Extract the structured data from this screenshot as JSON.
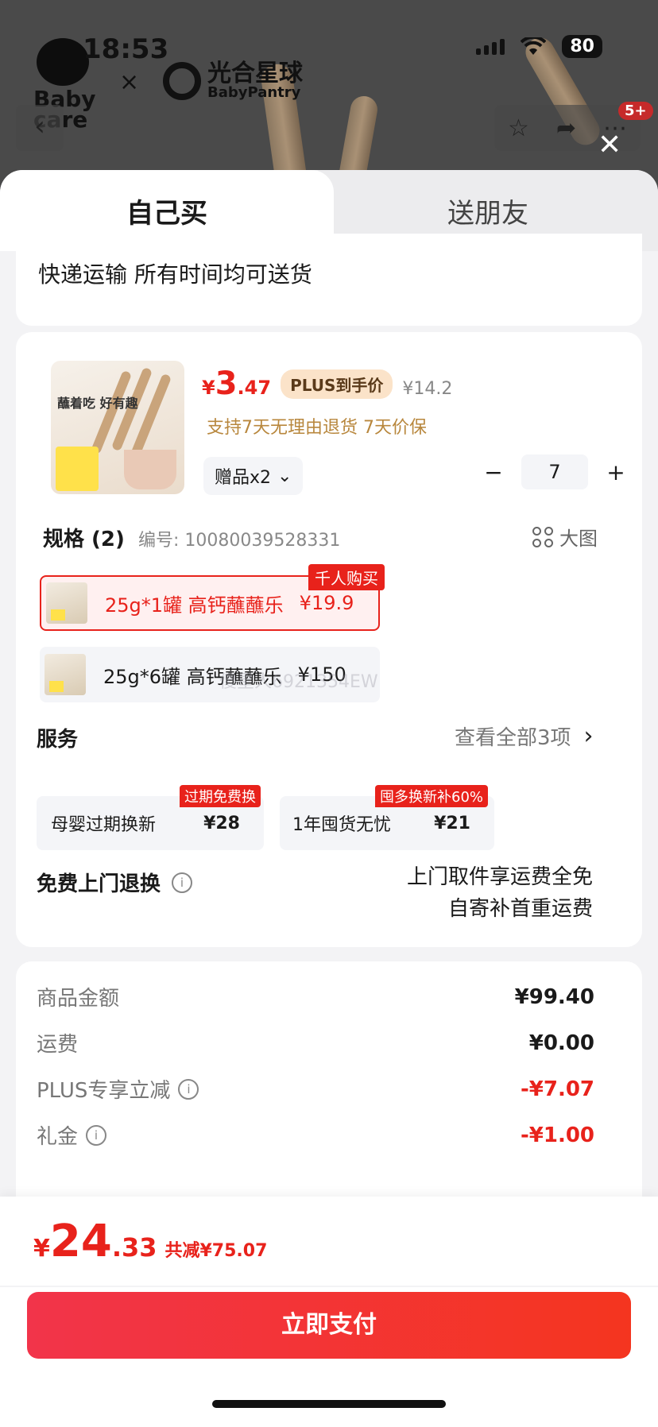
{
  "status_bar": {
    "time": "18:53",
    "battery": "80"
  },
  "header": {
    "brand_left": "Baby care",
    "brand_separator": "×",
    "brand_right_cn": "光合星球",
    "brand_right_en": "BabyPantry",
    "notification_count": "5+"
  },
  "tabs": {
    "self": "自己买",
    "gift": "送朋友"
  },
  "delivery": {
    "text": "快递运输 所有时间均可送货"
  },
  "product": {
    "thumb_text": "蘸着吃 好有趣",
    "price_currency": "¥",
    "price_int": "3",
    "price_dec": ".47",
    "plus_label": "PLUS到手价",
    "original_price": "¥14.2",
    "support_text": "支持7天无理由退货  7天价保",
    "gift_label": "赠品x2",
    "quantity": "7",
    "minus": "−",
    "plus": "+"
  },
  "spec": {
    "title": "规格 (2)",
    "code": "编号: 10080039528331",
    "big_image": "大图",
    "options": [
      {
        "name": "25g*1罐 高钙蘸蘸乐",
        "price": "¥19.9",
        "badge": "千人购买",
        "selected": true
      },
      {
        "name": "25g*6罐 高钙蘸蘸乐",
        "price": "¥150",
        "selected": false
      }
    ],
    "watermark": "傻星人6921354EW"
  },
  "services": {
    "title": "服务",
    "view_all": "查看全部3项",
    "items": [
      {
        "name": "母婴过期换新",
        "price": "¥28",
        "badge": "过期免费换"
      },
      {
        "name": "1年囤货无忧",
        "price": "¥21",
        "badge": "囤多换新补60%"
      }
    ]
  },
  "free_return": {
    "title": "免费上门退换",
    "line1": "上门取件享运费全免",
    "line2": "自寄补首重运费"
  },
  "summary": {
    "rows": [
      {
        "label": "商品金额",
        "value": "¥99.40"
      },
      {
        "label": "运费",
        "value": "¥0.00"
      },
      {
        "label": "PLUS专享立减",
        "value": "-¥7.07"
      },
      {
        "label": "礼金",
        "value": "-¥1.00"
      }
    ]
  },
  "footer": {
    "currency": "¥",
    "total_int": "24",
    "total_dec": ".33",
    "saved": "共减¥75.07",
    "pay_label": "立即支付"
  },
  "colors": {
    "accent_red": "#e8221b",
    "gold": "#b8873d"
  }
}
